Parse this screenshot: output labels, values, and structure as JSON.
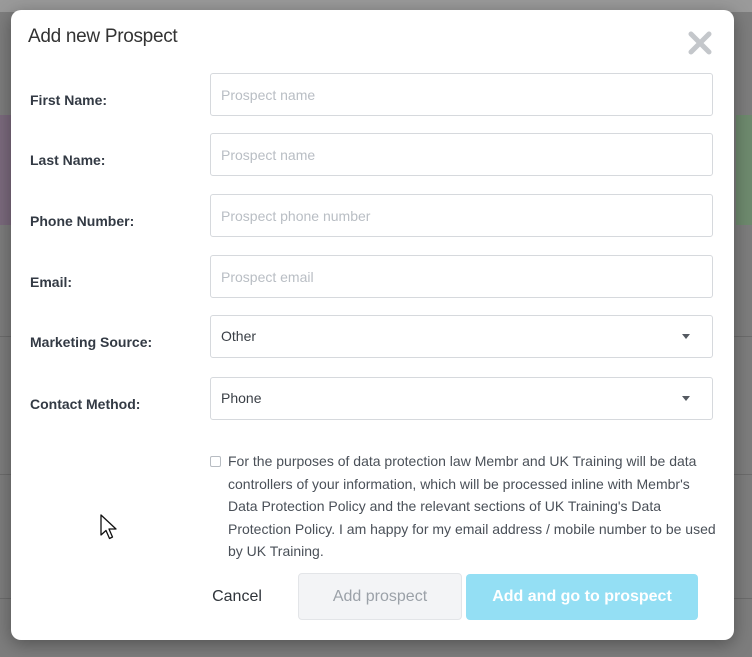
{
  "modal": {
    "title": "Add new Prospect",
    "close_icon": "close-icon"
  },
  "form": {
    "first_name": {
      "label": "First Name:",
      "placeholder": "Prospect name",
      "value": ""
    },
    "last_name": {
      "label": "Last Name:",
      "placeholder": "Prospect name",
      "value": ""
    },
    "phone": {
      "label": "Phone Number:",
      "placeholder": "Prospect phone number",
      "value": ""
    },
    "email": {
      "label": "Email:",
      "placeholder": "Prospect email",
      "value": ""
    },
    "marketing_source": {
      "label": "Marketing Source:",
      "selected": "Other",
      "icon": "chevron-down-icon"
    },
    "contact_method": {
      "label": "Contact Method:",
      "selected": "Phone",
      "icon": "chevron-down-icon"
    }
  },
  "consent": {
    "checked": false,
    "text": "For the purposes of data protection law Membr and UK Training will be data controllers of your information, which will be processed inline with Membr's Data Protection Policy and the relevant sections of UK Training's Data Protection Policy. I am happy for my email address / mobile number to be used by UK Training."
  },
  "actions": {
    "cancel_label": "Cancel",
    "add_label": "Add prospect",
    "add_go_label": "Add and go to prospect"
  },
  "colors": {
    "primary_button": "#94dff4",
    "disabled_button": "#f3f4f6",
    "overlay": "#7d7d7d"
  }
}
